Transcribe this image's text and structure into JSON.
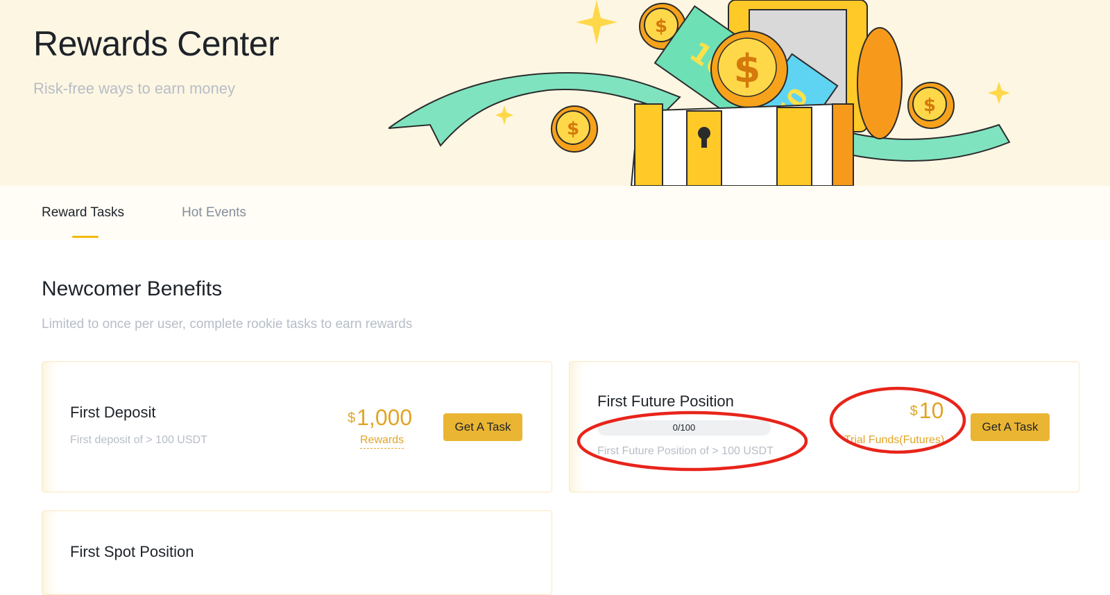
{
  "hero": {
    "title": "Rewards Center",
    "subtitle": "Risk-free ways to earn money"
  },
  "tabs": [
    {
      "label": "Reward Tasks",
      "active": true
    },
    {
      "label": "Hot Events",
      "active": false
    }
  ],
  "section": {
    "title": "Newcomer Benefits",
    "subtitle": "Limited to once per user, complete rookie tasks to earn rewards"
  },
  "cards": [
    {
      "title": "First Deposit",
      "description": "First deposit of > 100 USDT",
      "currency": "$",
      "amount": "1,000",
      "reward_label": "Rewards",
      "button": "Get A Task"
    },
    {
      "title": "First Future Position",
      "description": "First Future Position of > 100 USDT",
      "progress_text": "0/100",
      "progress_fraction": 0,
      "currency": "$",
      "amount": "10",
      "reward_label": "Trial Funds(Futures)",
      "button": "Get A Task"
    },
    {
      "title": "First Spot Position"
    }
  ],
  "colors": {
    "accent": "#F0B90B",
    "reward_text": "#E0A526",
    "hero_bg": "#FDF6E3",
    "annotation": "#E8241A"
  }
}
